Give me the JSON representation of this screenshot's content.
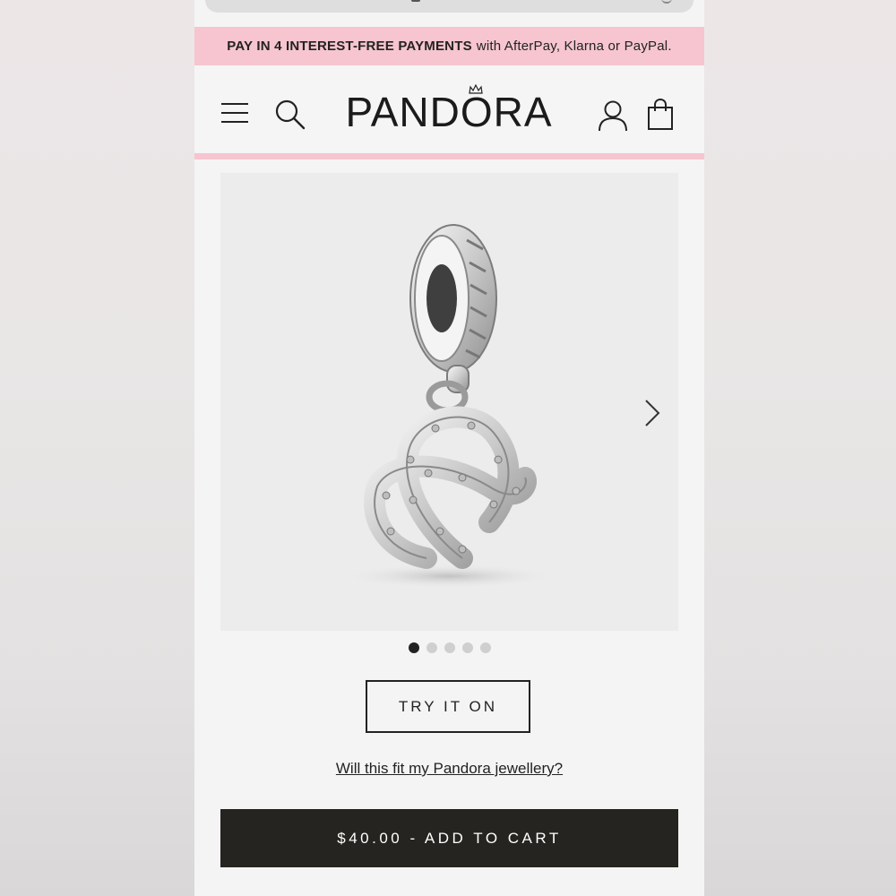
{
  "promo": {
    "bold": "PAY IN 4 INTEREST-FREE PAYMENTS",
    "rest": "with AfterPay, Klarna or PayPal."
  },
  "header": {
    "logo": "PANDORA",
    "icons": [
      "menu-icon",
      "search-icon",
      "account-icon",
      "shopping-bag-icon"
    ]
  },
  "gallery": {
    "image": "silver pretzel dangle charm",
    "dots_total": 5,
    "active_index": 0
  },
  "actions": {
    "try_on_label": "TRY IT ON",
    "fit_link": "Will this fit my Pandora jewellery?",
    "cart_label": "$40.00 - ADD TO CART"
  },
  "colors": {
    "promo_bg": "#f6c5cf",
    "cart_bg": "#262420",
    "text": "#222222"
  }
}
